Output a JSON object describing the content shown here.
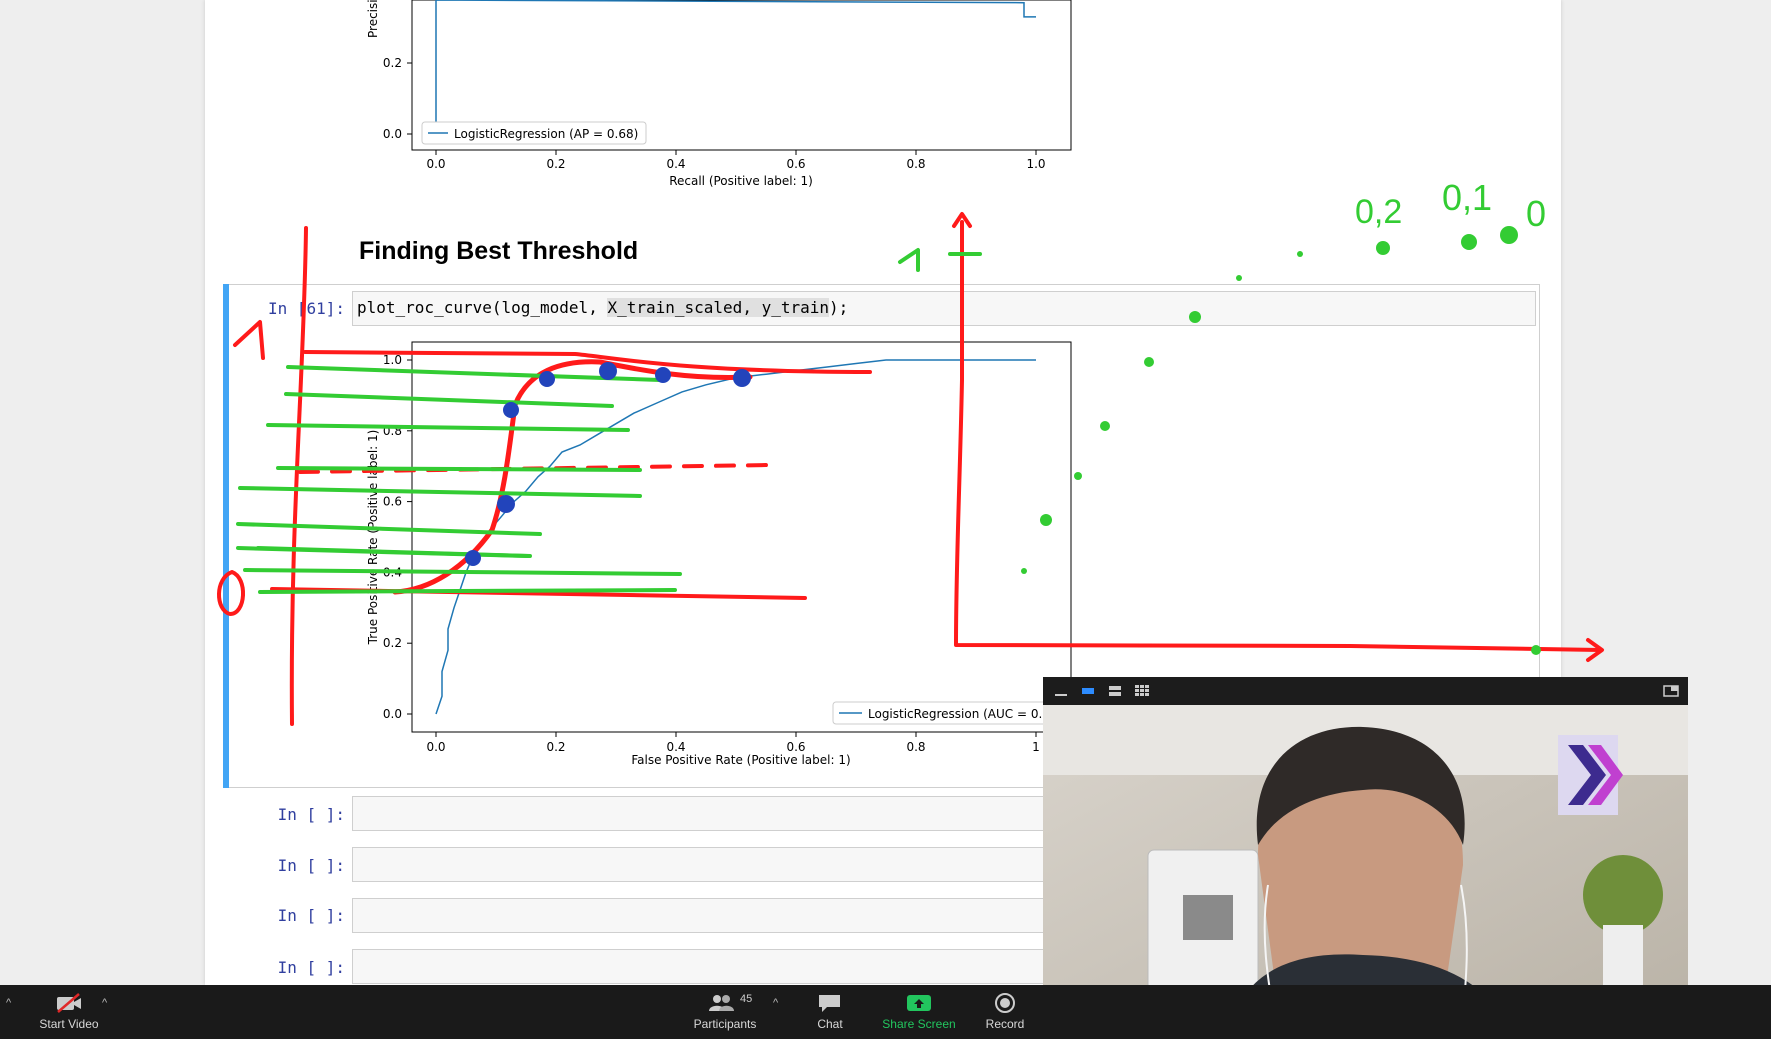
{
  "notebook": {
    "pr_chart": {
      "legend": "LogisticRegression (AP = 0.68)",
      "ylabel_partial": "Precisi",
      "xlabel": "Recall (Positive label: 1)",
      "y_ticks": [
        "0.2",
        "0.0"
      ],
      "x_ticks": [
        "0.0",
        "0.2",
        "0.4",
        "0.6",
        "0.8",
        "1.0"
      ]
    },
    "heading": "Finding Best Threshold",
    "cell61": {
      "prompt": "In [61]:",
      "code_before": "plot_roc_curve(log_model, ",
      "code_highlight": "X_train_scaled, y_train",
      "code_after": ");"
    },
    "roc_chart": {
      "legend": "LogisticRegression (AUC = 0.",
      "xlabel": "False Positive Rate (Positive label: 1)",
      "ylabel": "True Positive Rate (Positive label: 1)",
      "y_ticks": [
        "1.0",
        "0.8",
        "0.6",
        "0.4",
        "0.2",
        "0.0"
      ],
      "x_ticks": [
        "0.0",
        "0.2",
        "0.4",
        "0.6",
        "0.8",
        "1"
      ]
    },
    "empty_cells": [
      {
        "prompt": "In [ ]:"
      },
      {
        "prompt": "In [ ]:"
      },
      {
        "prompt": "In [ ]:"
      },
      {
        "prompt": "In [ ]:"
      }
    ]
  },
  "chart_data": [
    {
      "type": "line",
      "xlabel": "Recall (Positive label: 1)",
      "ylabel": "Precisi",
      "xlim": [
        0,
        1
      ],
      "series": [
        {
          "name": "LogisticRegression (AP = 0.68)",
          "x": [
            0.0,
            0.0,
            0.98,
            0.98,
            1.0
          ],
          "y": [
            0.0,
            1.0,
            0.37,
            0.33,
            0.33
          ]
        }
      ]
    },
    {
      "type": "line",
      "xlabel": "False Positive Rate (Positive label: 1)",
      "ylabel": "True Positive Rate (Positive label: 1)",
      "xlim": [
        0,
        1
      ],
      "ylim": [
        0,
        1
      ],
      "series": [
        {
          "name": "LogisticRegression (AUC = 0.",
          "x": [
            0.0,
            0.01,
            0.01,
            0.02,
            0.02,
            0.03,
            0.04,
            0.05,
            0.06,
            0.08,
            0.09,
            0.11,
            0.13,
            0.15,
            0.17,
            0.19,
            0.21,
            0.24,
            0.27,
            0.3,
            0.33,
            0.37,
            0.41,
            0.45,
            0.5,
            0.55,
            0.6,
            0.65,
            0.7,
            0.75,
            0.8,
            0.85,
            0.9,
            1.0
          ],
          "y": [
            0.0,
            0.05,
            0.12,
            0.18,
            0.24,
            0.3,
            0.35,
            0.4,
            0.44,
            0.49,
            0.52,
            0.56,
            0.6,
            0.63,
            0.67,
            0.7,
            0.74,
            0.76,
            0.79,
            0.82,
            0.85,
            0.88,
            0.91,
            0.93,
            0.95,
            0.96,
            0.97,
            0.98,
            0.99,
            1.0,
            1.0,
            1.0,
            1.0,
            1.0
          ]
        }
      ]
    }
  ],
  "annotation_labels": [
    "1",
    "1",
    "0,2",
    "0,1",
    "0"
  ],
  "video": {
    "badge_colors": [
      "#3d2b8f",
      "#c040d0"
    ]
  },
  "toolbar": {
    "start_video": "Start Video",
    "participants": "Participants",
    "participant_count": "45",
    "chat": "Chat",
    "share_screen": "Share Screen",
    "record": "Record"
  },
  "colors": {
    "prompt_blue": "#303f9f",
    "selected_cell": "#42a5f5",
    "series": "#1f77b4",
    "ink_red": "#ff1a1a",
    "ink_green": "#33cc33",
    "ink_blue": "#2244bb",
    "share_green": "#22c55e"
  }
}
